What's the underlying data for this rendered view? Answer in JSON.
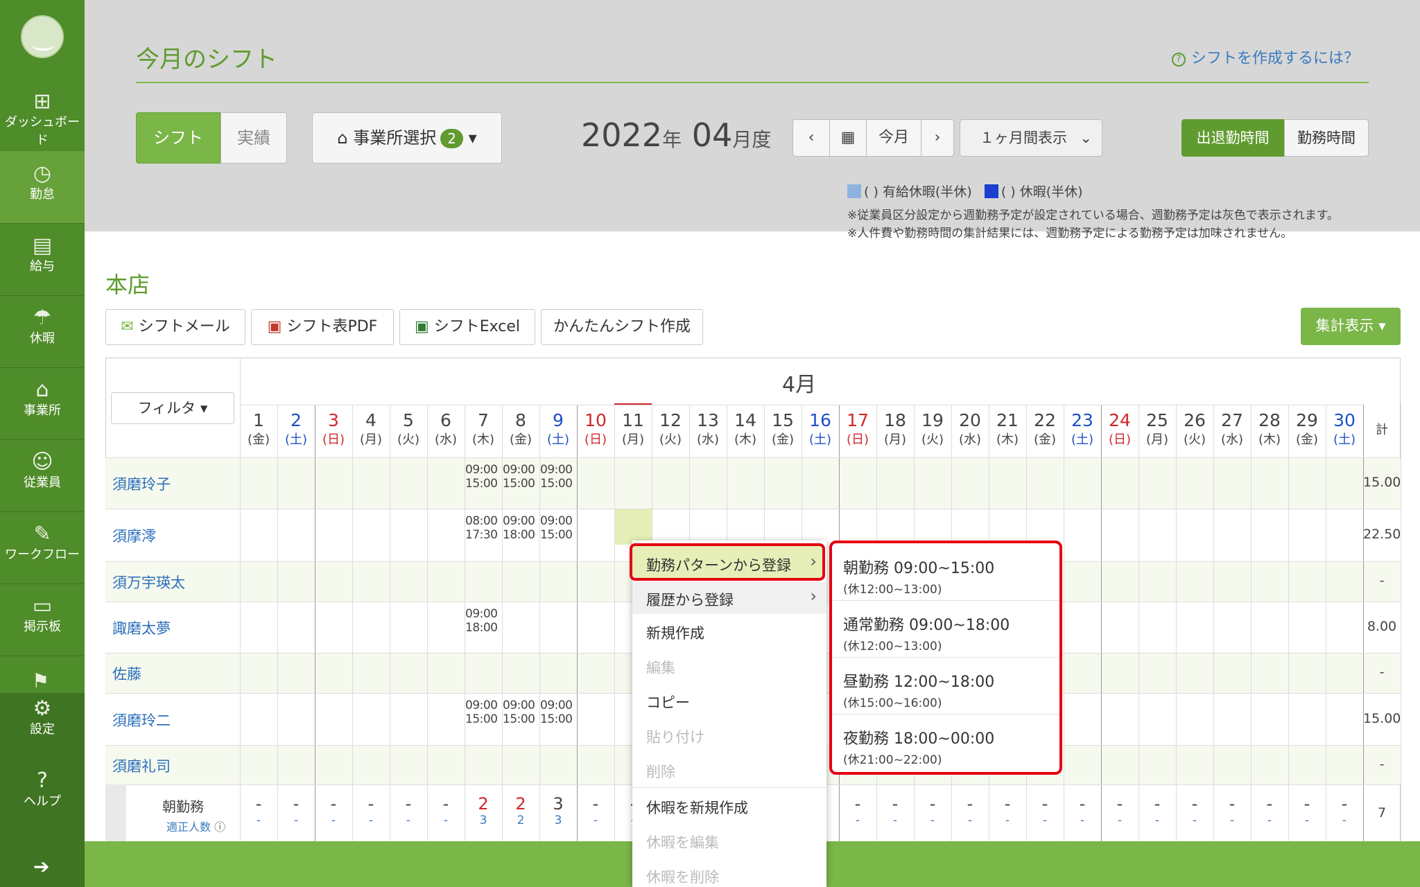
{
  "sidebar": {
    "items": [
      {
        "label": "ダッシュボード",
        "icon": "grid-icon"
      },
      {
        "label": "勤怠",
        "icon": "clock-icon"
      },
      {
        "label": "給与",
        "icon": "calculator-icon"
      },
      {
        "label": "休暇",
        "icon": "umbrella-icon"
      },
      {
        "label": "事業所",
        "icon": "house-icon"
      },
      {
        "label": "従業員",
        "icon": "person-icon"
      },
      {
        "label": "ワークフロー",
        "icon": "clipboard-icon"
      },
      {
        "label": "掲示板",
        "icon": "chat-icon"
      },
      {
        "label": "設定",
        "icon": "gear-icon"
      },
      {
        "label": "ヘルプ",
        "icon": "question-icon"
      }
    ]
  },
  "header": {
    "title": "今月のシフト",
    "help_link": "シフトを作成するには？",
    "tab_shift": "シフト",
    "tab_actual": "実績",
    "office_select": "事業所選択",
    "office_count": "2",
    "year": "2022",
    "year_unit": "年",
    "month": "04",
    "month_unit": "月度",
    "today": "今月",
    "period": "１ヶ月間表示",
    "btn_attend": "出退勤時間",
    "btn_work": "勤務時間",
    "legend_paid": "(  ) 有給休暇(半休)",
    "legend_leave": "(  ) 休暇(半休)",
    "note1": "※従業員区分設定から週勤務予定が設定されている場合、週勤務予定は灰色で表示されます。",
    "note2": "※人件費や勤務時間の集計結果には、週勤務予定による勤務予定は加味されません。"
  },
  "content": {
    "store": "本店",
    "btn_mail": "シフトメール",
    "btn_pdf": "シフト表PDF",
    "btn_excel": "シフトExcel",
    "btn_easy": "かんたんシフト作成",
    "btn_summary": "集計表示 ▾",
    "filter": "フィルタ ▾",
    "month_label": "4月",
    "total_header": "計"
  },
  "days": [
    {
      "d": "1",
      "w": "(金)"
    },
    {
      "d": "2",
      "w": "(土)"
    },
    {
      "d": "3",
      "w": "(日)"
    },
    {
      "d": "4",
      "w": "(月)"
    },
    {
      "d": "5",
      "w": "(火)"
    },
    {
      "d": "6",
      "w": "(水)"
    },
    {
      "d": "7",
      "w": "(木)"
    },
    {
      "d": "8",
      "w": "(金)"
    },
    {
      "d": "9",
      "w": "(土)"
    },
    {
      "d": "10",
      "w": "(日)"
    },
    {
      "d": "11",
      "w": "(月)"
    },
    {
      "d": "12",
      "w": "(火)"
    },
    {
      "d": "13",
      "w": "(水)"
    },
    {
      "d": "14",
      "w": "(木)"
    },
    {
      "d": "15",
      "w": "(金)"
    },
    {
      "d": "16",
      "w": "(土)"
    },
    {
      "d": "17",
      "w": "(日)"
    },
    {
      "d": "18",
      "w": "(月)"
    },
    {
      "d": "19",
      "w": "(火)"
    },
    {
      "d": "20",
      "w": "(水)"
    },
    {
      "d": "21",
      "w": "(木)"
    },
    {
      "d": "22",
      "w": "(金)"
    },
    {
      "d": "23",
      "w": "(土)"
    },
    {
      "d": "24",
      "w": "(日)"
    },
    {
      "d": "25",
      "w": "(月)"
    },
    {
      "d": "26",
      "w": "(火)"
    },
    {
      "d": "27",
      "w": "(水)"
    },
    {
      "d": "28",
      "w": "(木)"
    },
    {
      "d": "29",
      "w": "(金)"
    },
    {
      "d": "30",
      "w": "(土)"
    }
  ],
  "employees": [
    {
      "name": "須磨玲子",
      "total": "15.00",
      "shifts": [
        {
          "day": 7,
          "text": "09:00\n15:00"
        },
        {
          "day": 8,
          "text": "09:00\n15:00"
        },
        {
          "day": 9,
          "text": "09:00\n15:00"
        }
      ]
    },
    {
      "name": "須摩澪",
      "total": "22.50",
      "shifts": [
        {
          "day": 7,
          "text": "08:00\n17:30"
        },
        {
          "day": 8,
          "text": "09:00\n18:00"
        },
        {
          "day": 9,
          "text": "09:00\n15:00"
        }
      ]
    },
    {
      "name": "須万宇瑛太",
      "total": "-",
      "shifts": []
    },
    {
      "name": "諏磨太夢",
      "total": "8.00",
      "shifts": [
        {
          "day": 7,
          "text": "09:00\n18:00"
        }
      ]
    },
    {
      "name": "佐藤",
      "total": "-",
      "shifts": []
    },
    {
      "name": "須磨玲二",
      "total": "15.00",
      "shifts": [
        {
          "day": 7,
          "text": "09:00\n15:00"
        },
        {
          "day": 8,
          "text": "09:00\n15:00"
        },
        {
          "day": 9,
          "text": "09:00\n15:00"
        }
      ]
    },
    {
      "name": "須磨礼司",
      "total": "-",
      "shifts": []
    }
  ],
  "footer_row": {
    "label": "朝勤務",
    "sub_label": "適正人数",
    "total": "7",
    "top": [
      "-",
      "-",
      "-",
      "-",
      "-",
      "-",
      "2",
      "2",
      "3",
      "-",
      "-",
      "",
      "",
      "",
      "",
      "",
      "-",
      "-",
      "-",
      "-",
      "-",
      "-",
      "-",
      "-",
      "-",
      "-",
      "-",
      "-",
      "-",
      "-"
    ],
    "bottom": [
      "-",
      "-",
      "-",
      "-",
      "-",
      "-",
      "3",
      "2",
      "3",
      "-",
      "-",
      "",
      "",
      "",
      "",
      "",
      "-",
      "-",
      "-",
      "-",
      "-",
      "-",
      "-",
      "-",
      "-",
      "-",
      "-",
      "-",
      "-",
      "-"
    ]
  },
  "context_menu": {
    "items": [
      {
        "label": "勤務パターンから登録",
        "disabled": false,
        "sub": true
      },
      {
        "label": "履歴から登録",
        "disabled": false,
        "sub": true
      },
      {
        "label": "新規作成",
        "disabled": false
      },
      {
        "label": "編集",
        "disabled": true
      },
      {
        "label": "コピー",
        "disabled": false
      },
      {
        "label": "貼り付け",
        "disabled": true
      },
      {
        "label": "削除",
        "disabled": true
      },
      {
        "label": "休暇を新規作成",
        "disabled": false
      },
      {
        "label": "休暇を編集",
        "disabled": true
      },
      {
        "label": "休暇を削除",
        "disabled": true
      }
    ]
  },
  "submenu": {
    "items": [
      {
        "label": "朝勤務 09:00~15:00",
        "break": "(休12:00~13:00)"
      },
      {
        "label": "通常勤務 09:00~18:00",
        "break": "(休12:00~13:00)"
      },
      {
        "label": "昼勤務 12:00~18:00",
        "break": "(休15:00~16:00)"
      },
      {
        "label": "夜勤務 18:00~00:00",
        "break": "(休21:00~22:00)"
      }
    ]
  },
  "colors": {
    "accent": "#7ab648",
    "sidebar": "#4f8c2a",
    "highlight": "#e50011",
    "paid_leave": "#8fb3e0",
    "leave": "#1d3fcf"
  }
}
